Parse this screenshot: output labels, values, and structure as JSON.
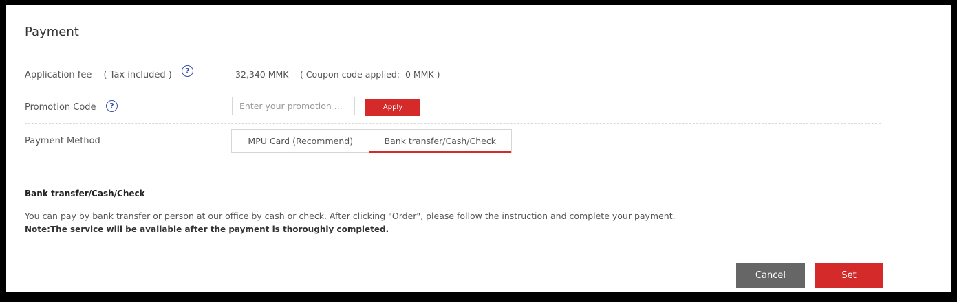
{
  "title": "Payment",
  "fee": {
    "label": "Application fee 　( Tax included )",
    "value": "32,340 MMK 　( Coupon code applied:  0 MMK )"
  },
  "promo": {
    "label": "Promotion Code",
    "placeholder": "Enter your promotion ...",
    "value": "",
    "apply_label": "Apply"
  },
  "method": {
    "label": "Payment Method",
    "tabs": [
      {
        "label": "MPU Card (Recommend)",
        "active": false
      },
      {
        "label": "Bank transfer/Cash/Check",
        "active": true
      }
    ]
  },
  "section": {
    "heading": "Bank transfer/Cash/Check",
    "description": "You can pay by bank transfer or person at our office by cash or check. After clicking \"Order\", please follow the instruction and complete your payment.",
    "note": "Note:The service will be available after the payment is thoroughly completed."
  },
  "buttons": {
    "cancel": "Cancel",
    "set": "Set"
  },
  "icons": {
    "help": "?"
  },
  "colors": {
    "accent": "#d42a2a",
    "cancel": "#666666",
    "help_icon": "#3b4fa8"
  }
}
